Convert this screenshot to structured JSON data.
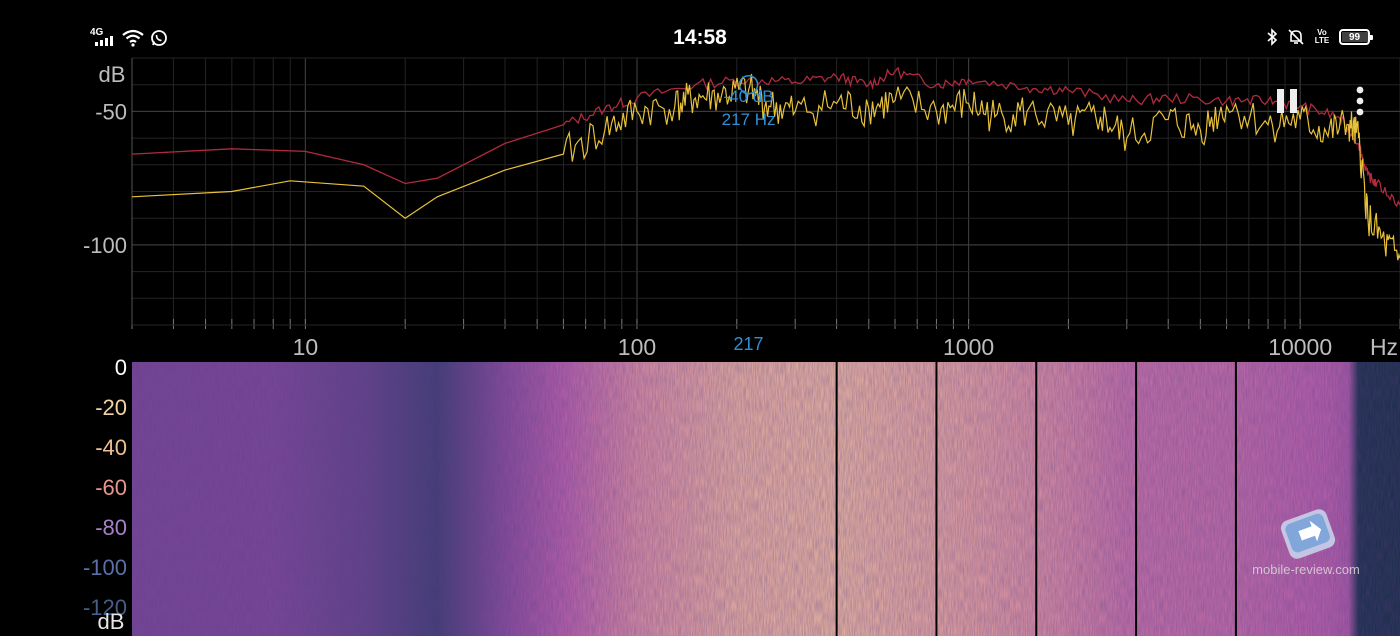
{
  "status_bar": {
    "network": "4G",
    "time": "14:58",
    "volte": "Vo LTE",
    "battery_level": "99",
    "icons": [
      "signal-icon",
      "wifi-icon",
      "whatsapp-icon",
      "bluetooth-icon",
      "mute-icon",
      "volte-icon",
      "battery-icon"
    ]
  },
  "controls": {
    "pause_icon": "pause-icon",
    "menu_icon": "more-vert-icon"
  },
  "colors": {
    "peak_line": "#b02a3e",
    "live_line": "#e8c13a",
    "cursor": "#2f8fd4",
    "grid": "#3a3a3a",
    "grid_fine": "#242424",
    "axis_text": "#bdbdbd"
  },
  "chart_data": [
    {
      "type": "line",
      "x_scale": "log",
      "xlim": [
        3,
        20000
      ],
      "ylim": [
        -130,
        -30
      ],
      "ylabel": "dB",
      "xlabel": "Hz",
      "x_ticks": [
        10,
        100,
        1000,
        10000
      ],
      "x_tick_labels": [
        "10",
        "100",
        "1000",
        "10000"
      ],
      "y_ticks": [
        -50,
        -100
      ],
      "y_tick_labels": [
        "-50",
        "-100"
      ],
      "grid": true,
      "cursor": {
        "freq": 217,
        "db": -40,
        "label_db": "-40 dB",
        "label_hz": "217 Hz",
        "axis_label": "217"
      },
      "series": [
        {
          "color": "#b02a3e",
          "x": [
            3,
            6,
            10,
            15,
            20,
            25,
            40,
            60,
            80,
            100,
            150,
            217,
            300,
            400,
            500,
            600,
            800,
            1000,
            1500,
            2000,
            3000,
            4000,
            6000,
            8000,
            10000,
            13000,
            15000,
            16000,
            17000,
            20000
          ],
          "y": [
            -66,
            -64,
            -65,
            -70,
            -77,
            -75,
            -62,
            -55,
            -49,
            -45,
            -40,
            -38,
            -39,
            -37,
            -40,
            -35,
            -40,
            -38,
            -41,
            -42,
            -46,
            -45,
            -46,
            -46,
            -48,
            -52,
            -62,
            -74,
            -77,
            -85
          ]
        },
        {
          "color": "#e8c13a",
          "x": [
            3,
            6,
            9,
            15,
            20,
            25,
            40,
            60,
            80,
            100,
            130,
            150,
            180,
            217,
            250,
            300,
            400,
            500,
            600,
            800,
            1000,
            1200,
            1500,
            2000,
            2500,
            3000,
            4000,
            5000,
            6000,
            8000,
            10000,
            12000,
            14000,
            15000,
            16000,
            18000,
            20000
          ],
          "y": [
            -82,
            -80,
            -76,
            -78,
            -90,
            -82,
            -72,
            -66,
            -57,
            -50,
            -48,
            -45,
            -44,
            -42,
            -48,
            -50,
            -47,
            -49,
            -46,
            -50,
            -47,
            -52,
            -50,
            -55,
            -52,
            -60,
            -53,
            -57,
            -48,
            -55,
            -53,
            -58,
            -55,
            -60,
            -90,
            -100,
            -105
          ]
        }
      ]
    },
    {
      "type": "heatmap",
      "ylabel": "dB",
      "y_tick_labels": [
        "0",
        "-20",
        "-40",
        "-60",
        "-80",
        "-100",
        "-120"
      ],
      "y_tick_colors": [
        "#ffffff",
        "#f3d3a6",
        "#eec091",
        "#e6968c",
        "#a781c8",
        "#5b6fa8",
        "#465e8a"
      ],
      "x_scale": "log",
      "xlim": [
        3,
        20000
      ],
      "intensity_by_freq": {
        "x": [
          3,
          8,
          15,
          25,
          40,
          60,
          100,
          200,
          400,
          1000,
          2000,
          3000,
          6000,
          12000,
          14000,
          15000,
          20000
        ],
        "level": [
          0.35,
          0.36,
          0.3,
          0.22,
          0.4,
          0.55,
          0.72,
          0.85,
          0.88,
          0.8,
          0.7,
          0.62,
          0.6,
          0.55,
          0.5,
          0.05,
          0.03
        ]
      },
      "time_markers_hz": [
        400,
        800,
        1600,
        3200,
        6400
      ]
    }
  ],
  "watermark": {
    "text": "mobile-review.com"
  }
}
